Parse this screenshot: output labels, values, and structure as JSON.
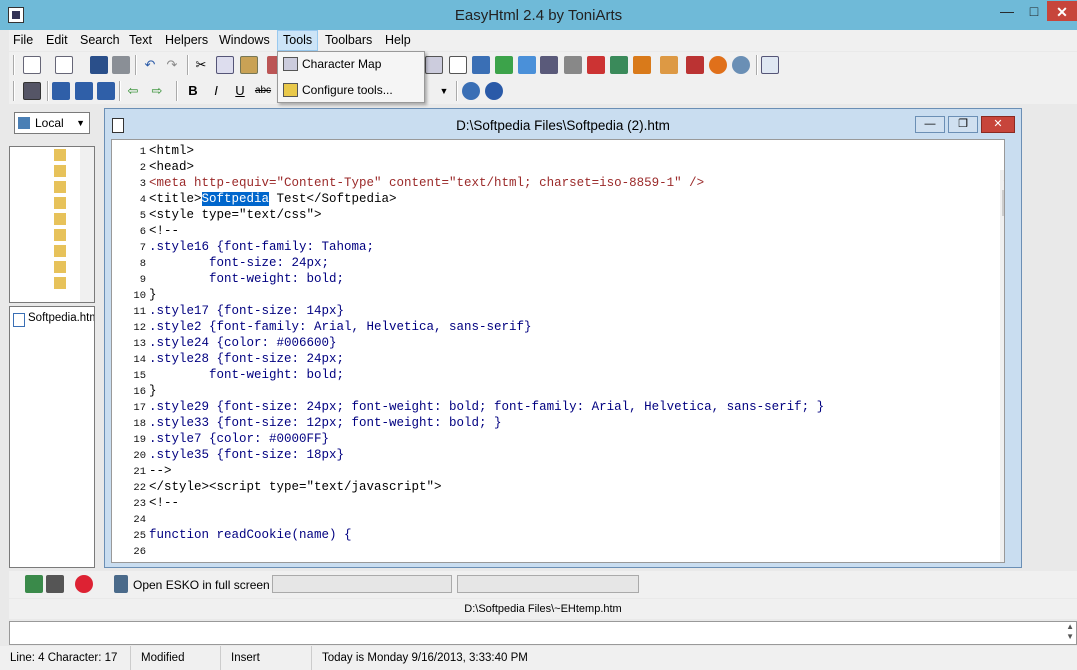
{
  "window": {
    "title": "EasyHtml 2.4 by ToniArts"
  },
  "menu": {
    "items": [
      "File",
      "Edit",
      "Search",
      "Text",
      "Helpers",
      "Windows",
      "Tools",
      "Toolbars",
      "Help"
    ],
    "active": "Tools"
  },
  "tools_menu": {
    "items": [
      "Character Map",
      "Configure tools..."
    ]
  },
  "format_toolbar": {
    "bold": "B",
    "italic": "I",
    "underline": "U",
    "strike": "abc"
  },
  "left_panel": {
    "drive_combo": "Local",
    "files": [
      "Softpedia.htm"
    ]
  },
  "editor": {
    "document_title": "D:\\Softpedia Files\\Softpedia (2).htm",
    "lines": [
      {
        "n": "1",
        "text": "<html>"
      },
      {
        "n": "2",
        "text": "<head>"
      },
      {
        "n": "3",
        "text": "<meta http-equiv=\"Content-Type\" content=\"text/html; charset=iso-8859-1\" />"
      },
      {
        "n": "4",
        "text": "<title>Softpedia Test</Softpedia>"
      },
      {
        "n": "5",
        "text": "<style type=\"text/css\">"
      },
      {
        "n": "6",
        "text": "<!--"
      },
      {
        "n": "7",
        "text": ".style16 {font-family: Tahoma;"
      },
      {
        "n": "8",
        "text": "        font-size: 24px;"
      },
      {
        "n": "9",
        "text": "        font-weight: bold;"
      },
      {
        "n": "10",
        "text": "}"
      },
      {
        "n": "11",
        "text": ".style17 {font-size: 14px}"
      },
      {
        "n": "12",
        "text": ".style2 {font-family: Arial, Helvetica, sans-serif}"
      },
      {
        "n": "13",
        "text": ".style24 {color: #006600}"
      },
      {
        "n": "14",
        "text": ".style28 {font-size: 24px;"
      },
      {
        "n": "15",
        "text": "        font-weight: bold;"
      },
      {
        "n": "16",
        "text": "}"
      },
      {
        "n": "17",
        "text": ".style29 {font-size: 24px; font-weight: bold; font-family: Arial, Helvetica, sans-serif; }"
      },
      {
        "n": "18",
        "text": ".style33 {font-size: 12px; font-weight: bold; }"
      },
      {
        "n": "19",
        "text": ".style7 {color: #0000FF}"
      },
      {
        "n": "20",
        "text": ".style35 {font-size: 18px}"
      },
      {
        "n": "21",
        "text": "-->"
      },
      {
        "n": "22",
        "text": "</style><script type=\"text/javascript\">"
      },
      {
        "n": "23",
        "text": "<!--"
      },
      {
        "n": "24",
        "text": ""
      },
      {
        "n": "25",
        "text": "function readCookie(name) {"
      },
      {
        "n": "26",
        "text": ""
      }
    ],
    "selected_text": "Softpedia"
  },
  "bottom_toolbar": {
    "fullscreen_label": "Open ESKO in full screen"
  },
  "path_bar": {
    "text": "D:\\Softpedia Files\\~EHtemp.htm"
  },
  "status": {
    "position": "Line: 4 Character: 17",
    "modified": "Modified",
    "mode": "Insert",
    "date": "Today is Monday 9/16/2013, 3:33:40 PM"
  },
  "colors": {
    "titlebar": "#6fbad8",
    "mdi_frame": "#c9ddf0",
    "menu_highlight": "#cce4f7",
    "close_button": "#c7453b",
    "selection": "#0066cc"
  }
}
